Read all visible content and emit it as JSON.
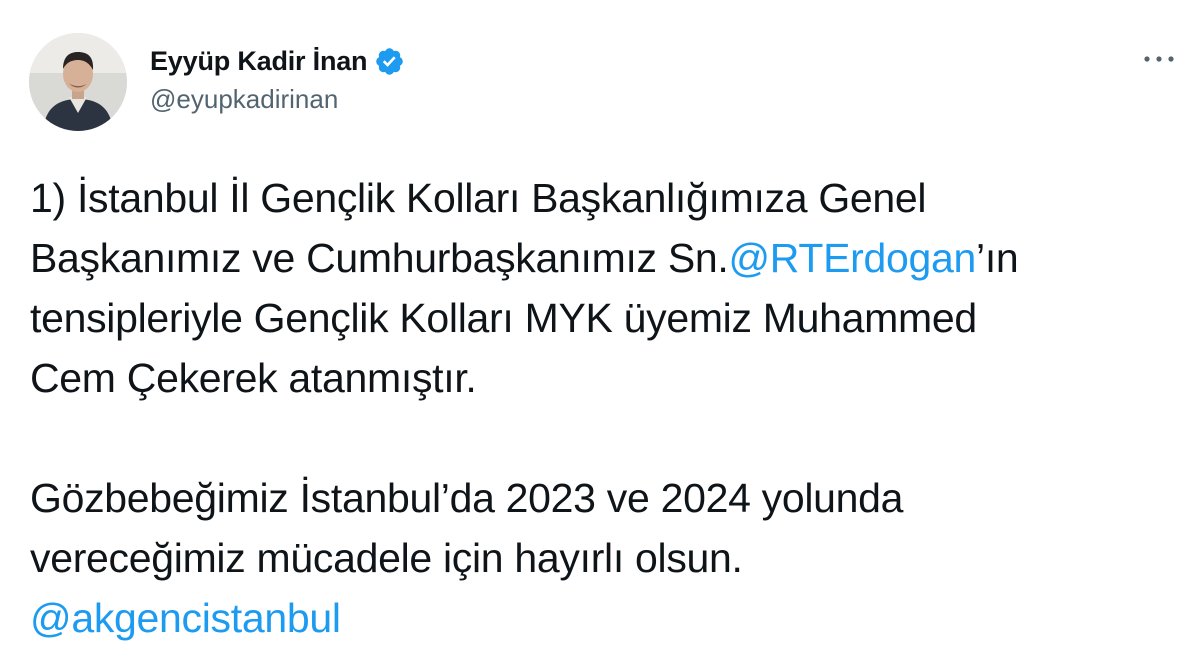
{
  "author": {
    "display_name": "Eyyüp Kadir İnan",
    "handle": "@eyupkadirinan",
    "verified_icon": "verified-badge-icon",
    "avatar_icon": "profile-photo"
  },
  "menu": {
    "icon": "more-options-icon"
  },
  "tweet": {
    "p1_l1": "1) İstanbul İl Gençlik Kolları Başkanlığımıza Genel",
    "p1_l2_pre": "Başkanımız ve Cumhurbaşkanımız Sn.",
    "p1_l2_mention": "@RTErdogan",
    "p1_l2_post": "’ın",
    "p1_l3": "tensipleriyle Gençlik Kolları MYK üyemiz Muhammed",
    "p1_l4": "Cem Çekerek atanmıştır.",
    "p2_l1": "Gözbebeğimiz İstanbul’da 2023 ve 2024 yolunda",
    "p2_l2": "vereceğimiz mücadele için hayırlı olsun.",
    "p2_mention": "@akgencistanbul"
  },
  "colors": {
    "link": "#1d9bf0",
    "text": "#0f1419",
    "secondary": "#536471"
  }
}
